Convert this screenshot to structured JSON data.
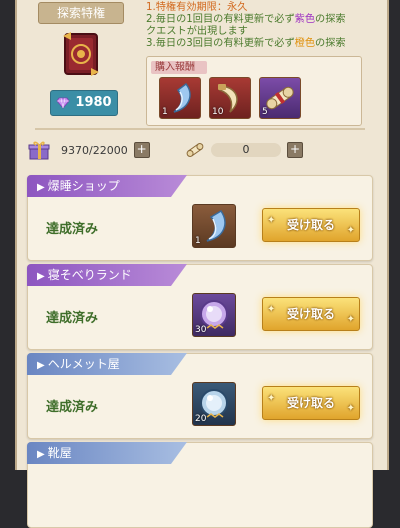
{
  "privilege": {
    "tag_label": "探索特権",
    "price": "1980",
    "desc_lines": [
      {
        "parts": [
          {
            "t": "1.",
            "c": "orange"
          },
          {
            "t": "特権有効期限：永久",
            "c": "orange"
          }
        ]
      },
      {
        "parts": [
          {
            "t": "2.毎日の1回目の有料更新で必ず",
            "c": "green"
          },
          {
            "t": "紫色",
            "c": "purple"
          },
          {
            "t": "の探索",
            "c": "green"
          }
        ]
      },
      {
        "parts": [
          {
            "t": "クエストが出現します",
            "c": "green"
          }
        ]
      },
      {
        "parts": [
          {
            "t": "3.毎日の3回目の有料更新で必ず",
            "c": "green"
          },
          {
            "t": "橙色",
            "c": "gold"
          },
          {
            "t": "の探索",
            "c": "green"
          }
        ]
      }
    ],
    "rewards_title": "購入報酬",
    "rewards": [
      {
        "icon": "blue-claw-icon",
        "count": "1",
        "bg": "red"
      },
      {
        "icon": "fang-icon",
        "count": "10",
        "bg": "red"
      },
      {
        "icon": "scroll-icon",
        "count": "5",
        "bg": "purple"
      }
    ]
  },
  "stats": {
    "progress_value": "9370/22000",
    "scroll_value": "0",
    "plus": "+"
  },
  "shops": [
    {
      "name": "爆睡ショップ",
      "status": "達成済み",
      "reward_count": "1",
      "reward_icon": "blue-claw-icon",
      "button": "受け取る",
      "header_color": "purple"
    },
    {
      "name": "寝そべりランド",
      "status": "達成済み",
      "reward_count": "30",
      "reward_icon": "purple-orb-icon",
      "button": "受け取る",
      "header_color": "purple"
    },
    {
      "name": "ヘルメット屋",
      "status": "達成済み",
      "reward_count": "20",
      "reward_icon": "blue-orb-icon",
      "button": "受け取る",
      "header_color": "blue"
    },
    {
      "name": "靴屋",
      "status": "",
      "reward_count": "",
      "reward_icon": "",
      "button": "",
      "header_color": "blue"
    }
  ]
}
